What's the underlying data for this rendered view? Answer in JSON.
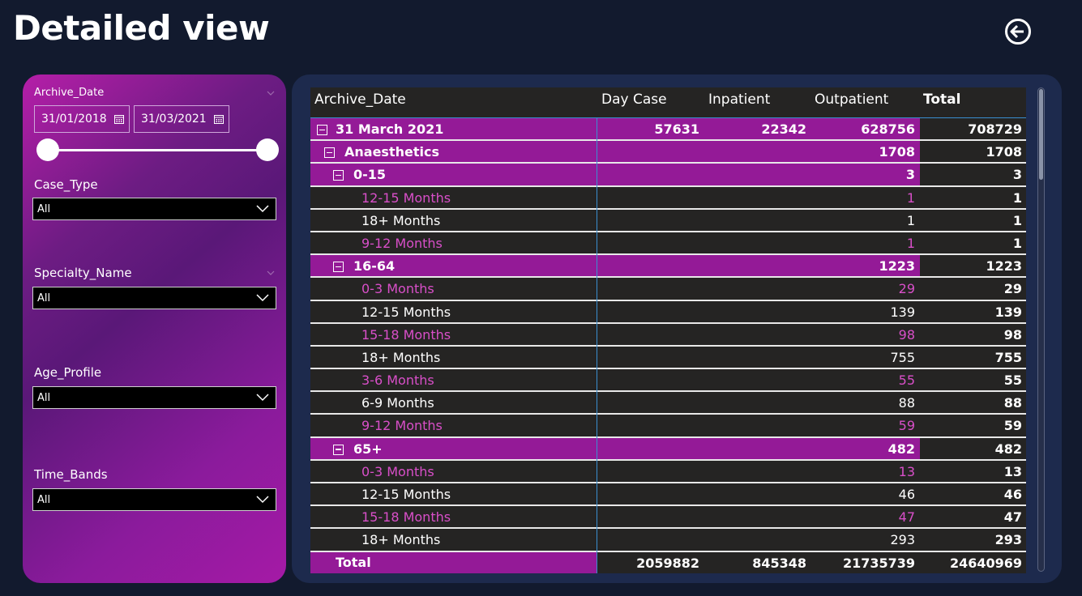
{
  "title": "Detailed view",
  "filters": {
    "archive_date": {
      "label": "Archive_Date",
      "start": "31/01/2018",
      "end": "31/03/2021"
    },
    "case_type": {
      "label": "Case_Type",
      "value": "All"
    },
    "specialty_name": {
      "label": "Specialty_Name",
      "value": "All"
    },
    "age_profile": {
      "label": "Age_Profile",
      "value": "All"
    },
    "time_bands": {
      "label": "Time_Bands",
      "value": "All"
    }
  },
  "table": {
    "headers": {
      "archive_date": "Archive_Date",
      "day_case": "Day Case",
      "inpatient": "Inpatient",
      "outpatient": "Outpatient",
      "total": "Total"
    },
    "rows": [
      {
        "level": 0,
        "kind": "group",
        "label": "31 March 2021",
        "day_case": "57631",
        "inpatient": "22342",
        "outpatient": "628756",
        "total": "708729"
      },
      {
        "level": 1,
        "kind": "group",
        "label": "Anaesthetics",
        "day_case": "",
        "inpatient": "",
        "outpatient": "1708",
        "total": "1708"
      },
      {
        "level": 2,
        "kind": "group",
        "label": "0-15",
        "day_case": "",
        "inpatient": "",
        "outpatient": "3",
        "total": "3"
      },
      {
        "level": 3,
        "kind": "leaf",
        "tone": "pink",
        "label": "12-15 Months",
        "outpatient": "1",
        "total": "1"
      },
      {
        "level": 3,
        "kind": "leaf",
        "tone": "white",
        "label": "18+ Months",
        "outpatient": "1",
        "total": "1"
      },
      {
        "level": 3,
        "kind": "leaf",
        "tone": "pink",
        "label": "9-12 Months",
        "outpatient": "1",
        "total": "1"
      },
      {
        "level": 2,
        "kind": "group",
        "label": "16-64",
        "day_case": "",
        "inpatient": "",
        "outpatient": "1223",
        "total": "1223"
      },
      {
        "level": 3,
        "kind": "leaf",
        "tone": "pink",
        "label": "0-3 Months",
        "outpatient": "29",
        "total": "29"
      },
      {
        "level": 3,
        "kind": "leaf",
        "tone": "white",
        "label": "12-15 Months",
        "outpatient": "139",
        "total": "139"
      },
      {
        "level": 3,
        "kind": "leaf",
        "tone": "pink",
        "label": "15-18 Months",
        "outpatient": "98",
        "total": "98"
      },
      {
        "level": 3,
        "kind": "leaf",
        "tone": "white",
        "label": "18+ Months",
        "outpatient": "755",
        "total": "755"
      },
      {
        "level": 3,
        "kind": "leaf",
        "tone": "pink",
        "label": "3-6 Months",
        "outpatient": "55",
        "total": "55"
      },
      {
        "level": 3,
        "kind": "leaf",
        "tone": "white",
        "label": "6-9 Months",
        "outpatient": "88",
        "total": "88"
      },
      {
        "level": 3,
        "kind": "leaf",
        "tone": "pink",
        "label": "9-12 Months",
        "outpatient": "59",
        "total": "59"
      },
      {
        "level": 2,
        "kind": "group",
        "label": "65+",
        "day_case": "",
        "inpatient": "",
        "outpatient": "482",
        "total": "482"
      },
      {
        "level": 3,
        "kind": "leaf",
        "tone": "pink",
        "label": "0-3 Months",
        "outpatient": "13",
        "total": "13"
      },
      {
        "level": 3,
        "kind": "leaf",
        "tone": "white",
        "label": "12-15 Months",
        "outpatient": "46",
        "total": "46"
      },
      {
        "level": 3,
        "kind": "leaf",
        "tone": "pink",
        "label": "15-18 Months",
        "outpatient": "47",
        "total": "47"
      },
      {
        "level": 3,
        "kind": "leaf",
        "tone": "white",
        "label": "18+ Months",
        "outpatient": "293",
        "total": "293"
      }
    ],
    "total": {
      "label": "Total",
      "day_case": "2059882",
      "inpatient": "845348",
      "outpatient": "21735739",
      "total": "24640969"
    }
  },
  "colors": {
    "background": "#121a2e",
    "accent_purple": "#941a97",
    "pink_text": "#d94fc9",
    "table_bg": "#252423",
    "panel_bg": "#1d2a4d"
  }
}
